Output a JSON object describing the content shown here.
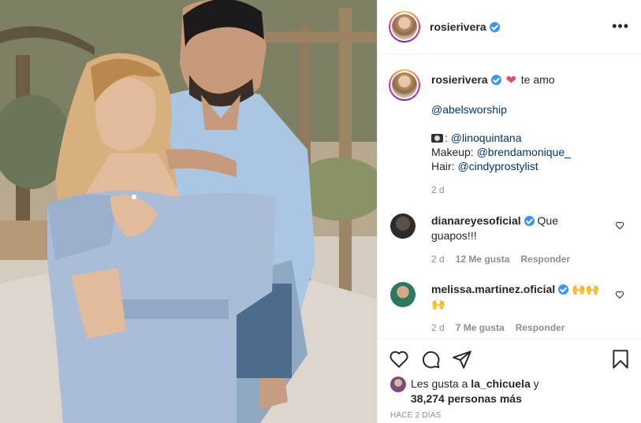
{
  "post": {
    "username": "rosierivera",
    "more_icon": "more-horizontal-icon"
  },
  "caption": {
    "username": "rosierivera",
    "emoji_heart": "❤",
    "text": "te amo",
    "mention_1": "@abelsworship",
    "photo_credit_icon": "camera-emoji",
    "photo_credit": "@linoquintana",
    "makeup_label": "Makeup:",
    "makeup": "@brendamonique_",
    "hair_label": "Hair:",
    "hair": "@cindyprostylist",
    "time": "2 d"
  },
  "comments": [
    {
      "username": "dianareyesoficial",
      "text": "Que guapos!!!",
      "time": "2 d",
      "likes": "12 Me gusta",
      "reply": "Responder"
    },
    {
      "username": "melissa.martinez.oficial",
      "text": "🙌🙌🙌",
      "time": "2 d",
      "likes": "7 Me gusta",
      "reply": "Responder"
    }
  ],
  "actions": {
    "like_icon": "heart-icon",
    "comment_icon": "comment-icon",
    "share_icon": "share-icon",
    "save_icon": "bookmark-icon"
  },
  "likes": {
    "prefix": "Les gusta a",
    "user": "la_chicuela",
    "connector": "y",
    "count": "38,274 personas más"
  },
  "timestamp": "HACE 2 DÍAS",
  "colors": {
    "verified": "#3897f0",
    "link": "#00376b",
    "muted": "#8e8e8e",
    "heart_emoji": "#ed4956"
  }
}
